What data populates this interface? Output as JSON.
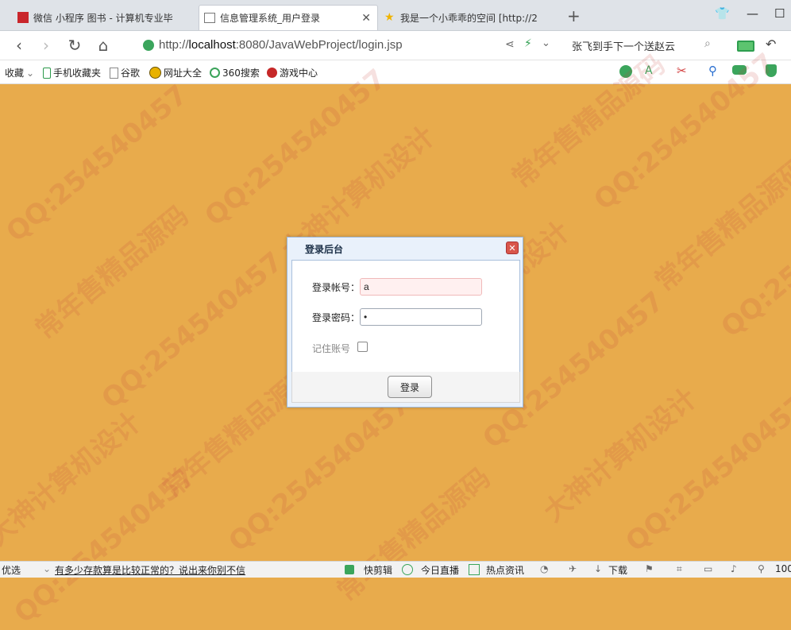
{
  "browser": {
    "tabs": [
      {
        "label": "微信 小程序 图书 - 计算机专业毕",
        "icon": "wechat-red-icon"
      },
      {
        "label": "信息管理系统_用户登录",
        "icon": "document-icon"
      },
      {
        "label": "我是一个小乖乖的空间 [http://2",
        "icon": "star-icon"
      }
    ],
    "new_tab": "+",
    "url_scheme": "http://",
    "url_host": "localhost",
    "url_rest": ":8080/JavaWebProject/login.jsp",
    "search_text": "张飞到手下一个送赵云",
    "bookmarks": [
      {
        "label": "收藏",
        "icon": "star-icon"
      },
      {
        "label": "手机收藏夹",
        "icon": "phone-icon"
      },
      {
        "label": "谷歌",
        "icon": "document-icon"
      },
      {
        "label": "网址大全",
        "icon": "globe-icon"
      },
      {
        "label": "360搜索",
        "icon": "search-icon"
      },
      {
        "label": "游戏中心",
        "icon": "game-icon"
      }
    ]
  },
  "dialog": {
    "title": "登录后台",
    "account_label": "登录帐号：",
    "account_value": "a",
    "password_label": "登录密码：",
    "password_value": "•",
    "remember_label": "记住账号",
    "login_button": "登录"
  },
  "statusbar": {
    "left": "优选",
    "news": "有多少存款算是比较正常的？说出来你别不信",
    "items": [
      "快剪辑",
      "今日直播",
      "热点资讯",
      "下载"
    ],
    "zoom": "100"
  },
  "watermarks": [
    "QQ:254540457",
    "常年售精品源码",
    "大神计算机设计"
  ]
}
